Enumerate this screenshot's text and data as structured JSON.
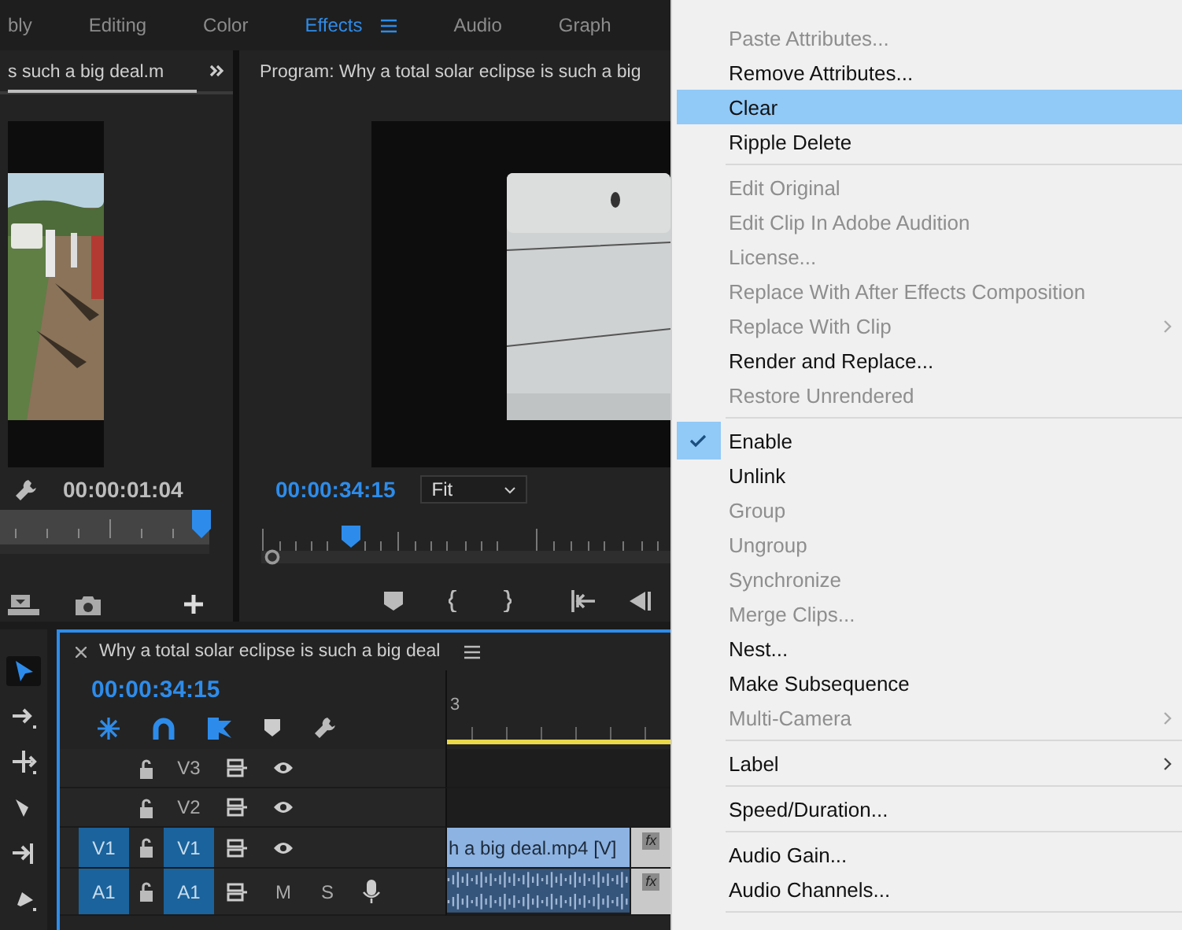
{
  "workspaces": [
    {
      "label": "bly",
      "selected": false
    },
    {
      "label": "Editing",
      "selected": false
    },
    {
      "label": "Color",
      "selected": false
    },
    {
      "label": "Effects",
      "selected": true
    },
    {
      "label": "Audio",
      "selected": false
    },
    {
      "label": "Graph",
      "selected": false
    }
  ],
  "source_monitor": {
    "tab": "s such a big deal.m",
    "timecode": "00:00:01:04",
    "level": 0.96
  },
  "program_monitor": {
    "title": "Program: Why a total solar eclipse is such a big",
    "timecode": "00:00:34:15",
    "zoom": "Fit",
    "level": 0.22
  },
  "tools": [
    {
      "kind": "selection",
      "selected": true
    },
    {
      "kind": "track-select",
      "selected": false
    },
    {
      "kind": "ripple",
      "selected": false
    },
    {
      "kind": "razor",
      "selected": false
    },
    {
      "kind": "slip",
      "selected": false
    },
    {
      "kind": "pen",
      "selected": false
    }
  ],
  "timeline": {
    "title": "Why a total solar eclipse is such a big deal",
    "timecode": "00:00:34:15",
    "ruler_label": "3",
    "tracks": [
      {
        "kind": "video",
        "name": "V3",
        "targeted": false
      },
      {
        "kind": "video",
        "name": "V2",
        "targeted": false
      },
      {
        "kind": "video",
        "source_patch": "V1",
        "name": "V1",
        "targeted": true,
        "clips": [
          {
            "kind": "video",
            "label": "h a big deal.mp4 [V]"
          },
          {
            "kind": "video",
            "badge": "fx"
          }
        ]
      },
      {
        "kind": "audio",
        "source_patch": "A1",
        "name": "A1",
        "targeted": true,
        "mute": "M",
        "solo": "S",
        "clips": [
          {
            "kind": "audio"
          },
          {
            "kind": "audio",
            "badge": "fx"
          }
        ]
      }
    ]
  },
  "context_menu": {
    "items": [
      {
        "kind": "item",
        "label": "Paste Attributes...",
        "disabled": true,
        "checked": false,
        "submenu": false,
        "selected": false
      },
      {
        "kind": "item",
        "label": "Remove Attributes...",
        "disabled": false,
        "checked": false,
        "submenu": false,
        "selected": false
      },
      {
        "kind": "item",
        "label": "Clear",
        "disabled": false,
        "checked": false,
        "submenu": false,
        "selected": true
      },
      {
        "kind": "item",
        "label": "Ripple Delete",
        "disabled": false,
        "checked": false,
        "submenu": false,
        "selected": false
      },
      {
        "kind": "separator"
      },
      {
        "kind": "item",
        "label": "Edit Original",
        "disabled": true,
        "checked": false,
        "submenu": false,
        "selected": false
      },
      {
        "kind": "item",
        "label": "Edit Clip In Adobe Audition",
        "disabled": true,
        "checked": false,
        "submenu": false,
        "selected": false
      },
      {
        "kind": "item",
        "label": "License...",
        "disabled": true,
        "checked": false,
        "submenu": false,
        "selected": false
      },
      {
        "kind": "item",
        "label": "Replace With After Effects Composition",
        "disabled": true,
        "checked": false,
        "submenu": false,
        "selected": false
      },
      {
        "kind": "item",
        "label": "Replace With Clip",
        "disabled": true,
        "checked": false,
        "submenu": true,
        "selected": false
      },
      {
        "kind": "item",
        "label": "Render and Replace...",
        "disabled": false,
        "checked": false,
        "submenu": false,
        "selected": false
      },
      {
        "kind": "item",
        "label": "Restore Unrendered",
        "disabled": true,
        "checked": false,
        "submenu": false,
        "selected": false
      },
      {
        "kind": "separator"
      },
      {
        "kind": "item",
        "label": "Enable",
        "disabled": false,
        "checked": true,
        "submenu": false,
        "selected": false
      },
      {
        "kind": "item",
        "label": "Unlink",
        "disabled": false,
        "checked": false,
        "submenu": false,
        "selected": false
      },
      {
        "kind": "item",
        "label": "Group",
        "disabled": true,
        "checked": false,
        "submenu": false,
        "selected": false
      },
      {
        "kind": "item",
        "label": "Ungroup",
        "disabled": true,
        "checked": false,
        "submenu": false,
        "selected": false
      },
      {
        "kind": "item",
        "label": "Synchronize",
        "disabled": true,
        "checked": false,
        "submenu": false,
        "selected": false
      },
      {
        "kind": "item",
        "label": "Merge Clips...",
        "disabled": true,
        "checked": false,
        "submenu": false,
        "selected": false
      },
      {
        "kind": "item",
        "label": "Nest...",
        "disabled": false,
        "checked": false,
        "submenu": false,
        "selected": false
      },
      {
        "kind": "item",
        "label": "Make Subsequence",
        "disabled": false,
        "checked": false,
        "submenu": false,
        "selected": false
      },
      {
        "kind": "item",
        "label": "Multi-Camera",
        "disabled": true,
        "checked": false,
        "submenu": true,
        "selected": false
      },
      {
        "kind": "separator"
      },
      {
        "kind": "item",
        "label": "Label",
        "disabled": false,
        "checked": false,
        "submenu": true,
        "selected": false
      },
      {
        "kind": "separator"
      },
      {
        "kind": "item",
        "label": "Speed/Duration...",
        "disabled": false,
        "checked": false,
        "submenu": false,
        "selected": false
      },
      {
        "kind": "separator"
      },
      {
        "kind": "item",
        "label": "Audio Gain...",
        "disabled": false,
        "checked": false,
        "submenu": false,
        "selected": false
      },
      {
        "kind": "item",
        "label": "Audio Channels...",
        "disabled": false,
        "checked": false,
        "submenu": false,
        "selected": false
      },
      {
        "kind": "separator"
      }
    ]
  }
}
